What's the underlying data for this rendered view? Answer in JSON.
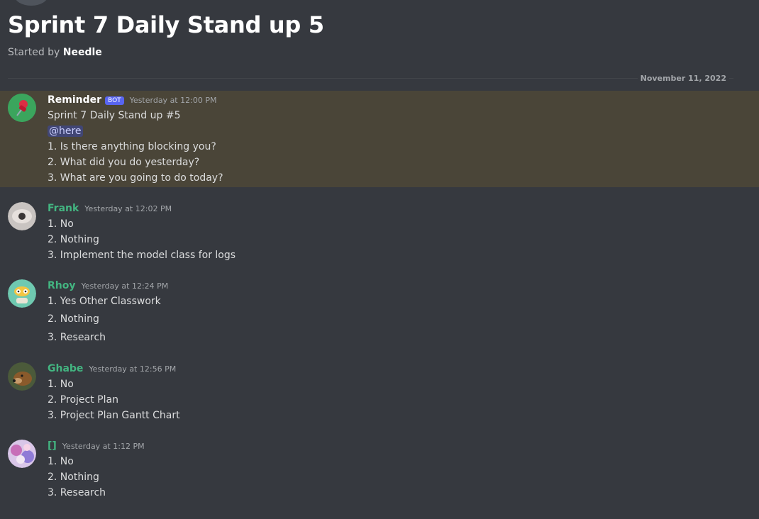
{
  "thread": {
    "title": "Sprint 7 Daily Stand up 5",
    "started_by_label": "Started by",
    "author": "Needle",
    "date_divider": "November 11, 2022"
  },
  "messages": [
    {
      "username": "Reminder",
      "badge": "BOT",
      "timestamp": "Yesterday at 12:00 PM",
      "lines": [
        "Sprint 7 Daily Stand up #5",
        "@here",
        "1. Is there anything blocking you?",
        "2. What did you do yesterday?",
        "3. What are you going to do today?"
      ],
      "avatar_icon": "pushpin-icon",
      "name_color": "#ffffff"
    },
    {
      "username": "Frank",
      "timestamp": "Yesterday at 12:02 PM",
      "lines": [
        "1. No",
        "2. Nothing",
        "3. Implement the model class for logs"
      ],
      "avatar_icon": "eye-avatar",
      "name_color": "#43b581"
    },
    {
      "username": "Rhoy",
      "timestamp": "Yesterday at 12:24 PM",
      "lines": [
        "1. Yes Other Classwork",
        "2. Nothing",
        "3. Research"
      ],
      "avatar_icon": "cartoon-avatar",
      "name_color": "#43b581"
    },
    {
      "username": "Ghabe",
      "timestamp": "Yesterday at 12:56 PM",
      "lines": [
        "1. No",
        "2. Project Plan",
        "3. Project Plan Gantt Chart"
      ],
      "avatar_icon": "dog-avatar",
      "name_color": "#43b581"
    },
    {
      "username": "[]",
      "timestamp": "Yesterday at 1:12 PM",
      "lines": [
        "1. No",
        "2. Nothing",
        "3. Research"
      ],
      "avatar_icon": "anime-avatar",
      "name_color": "#43b581"
    }
  ]
}
